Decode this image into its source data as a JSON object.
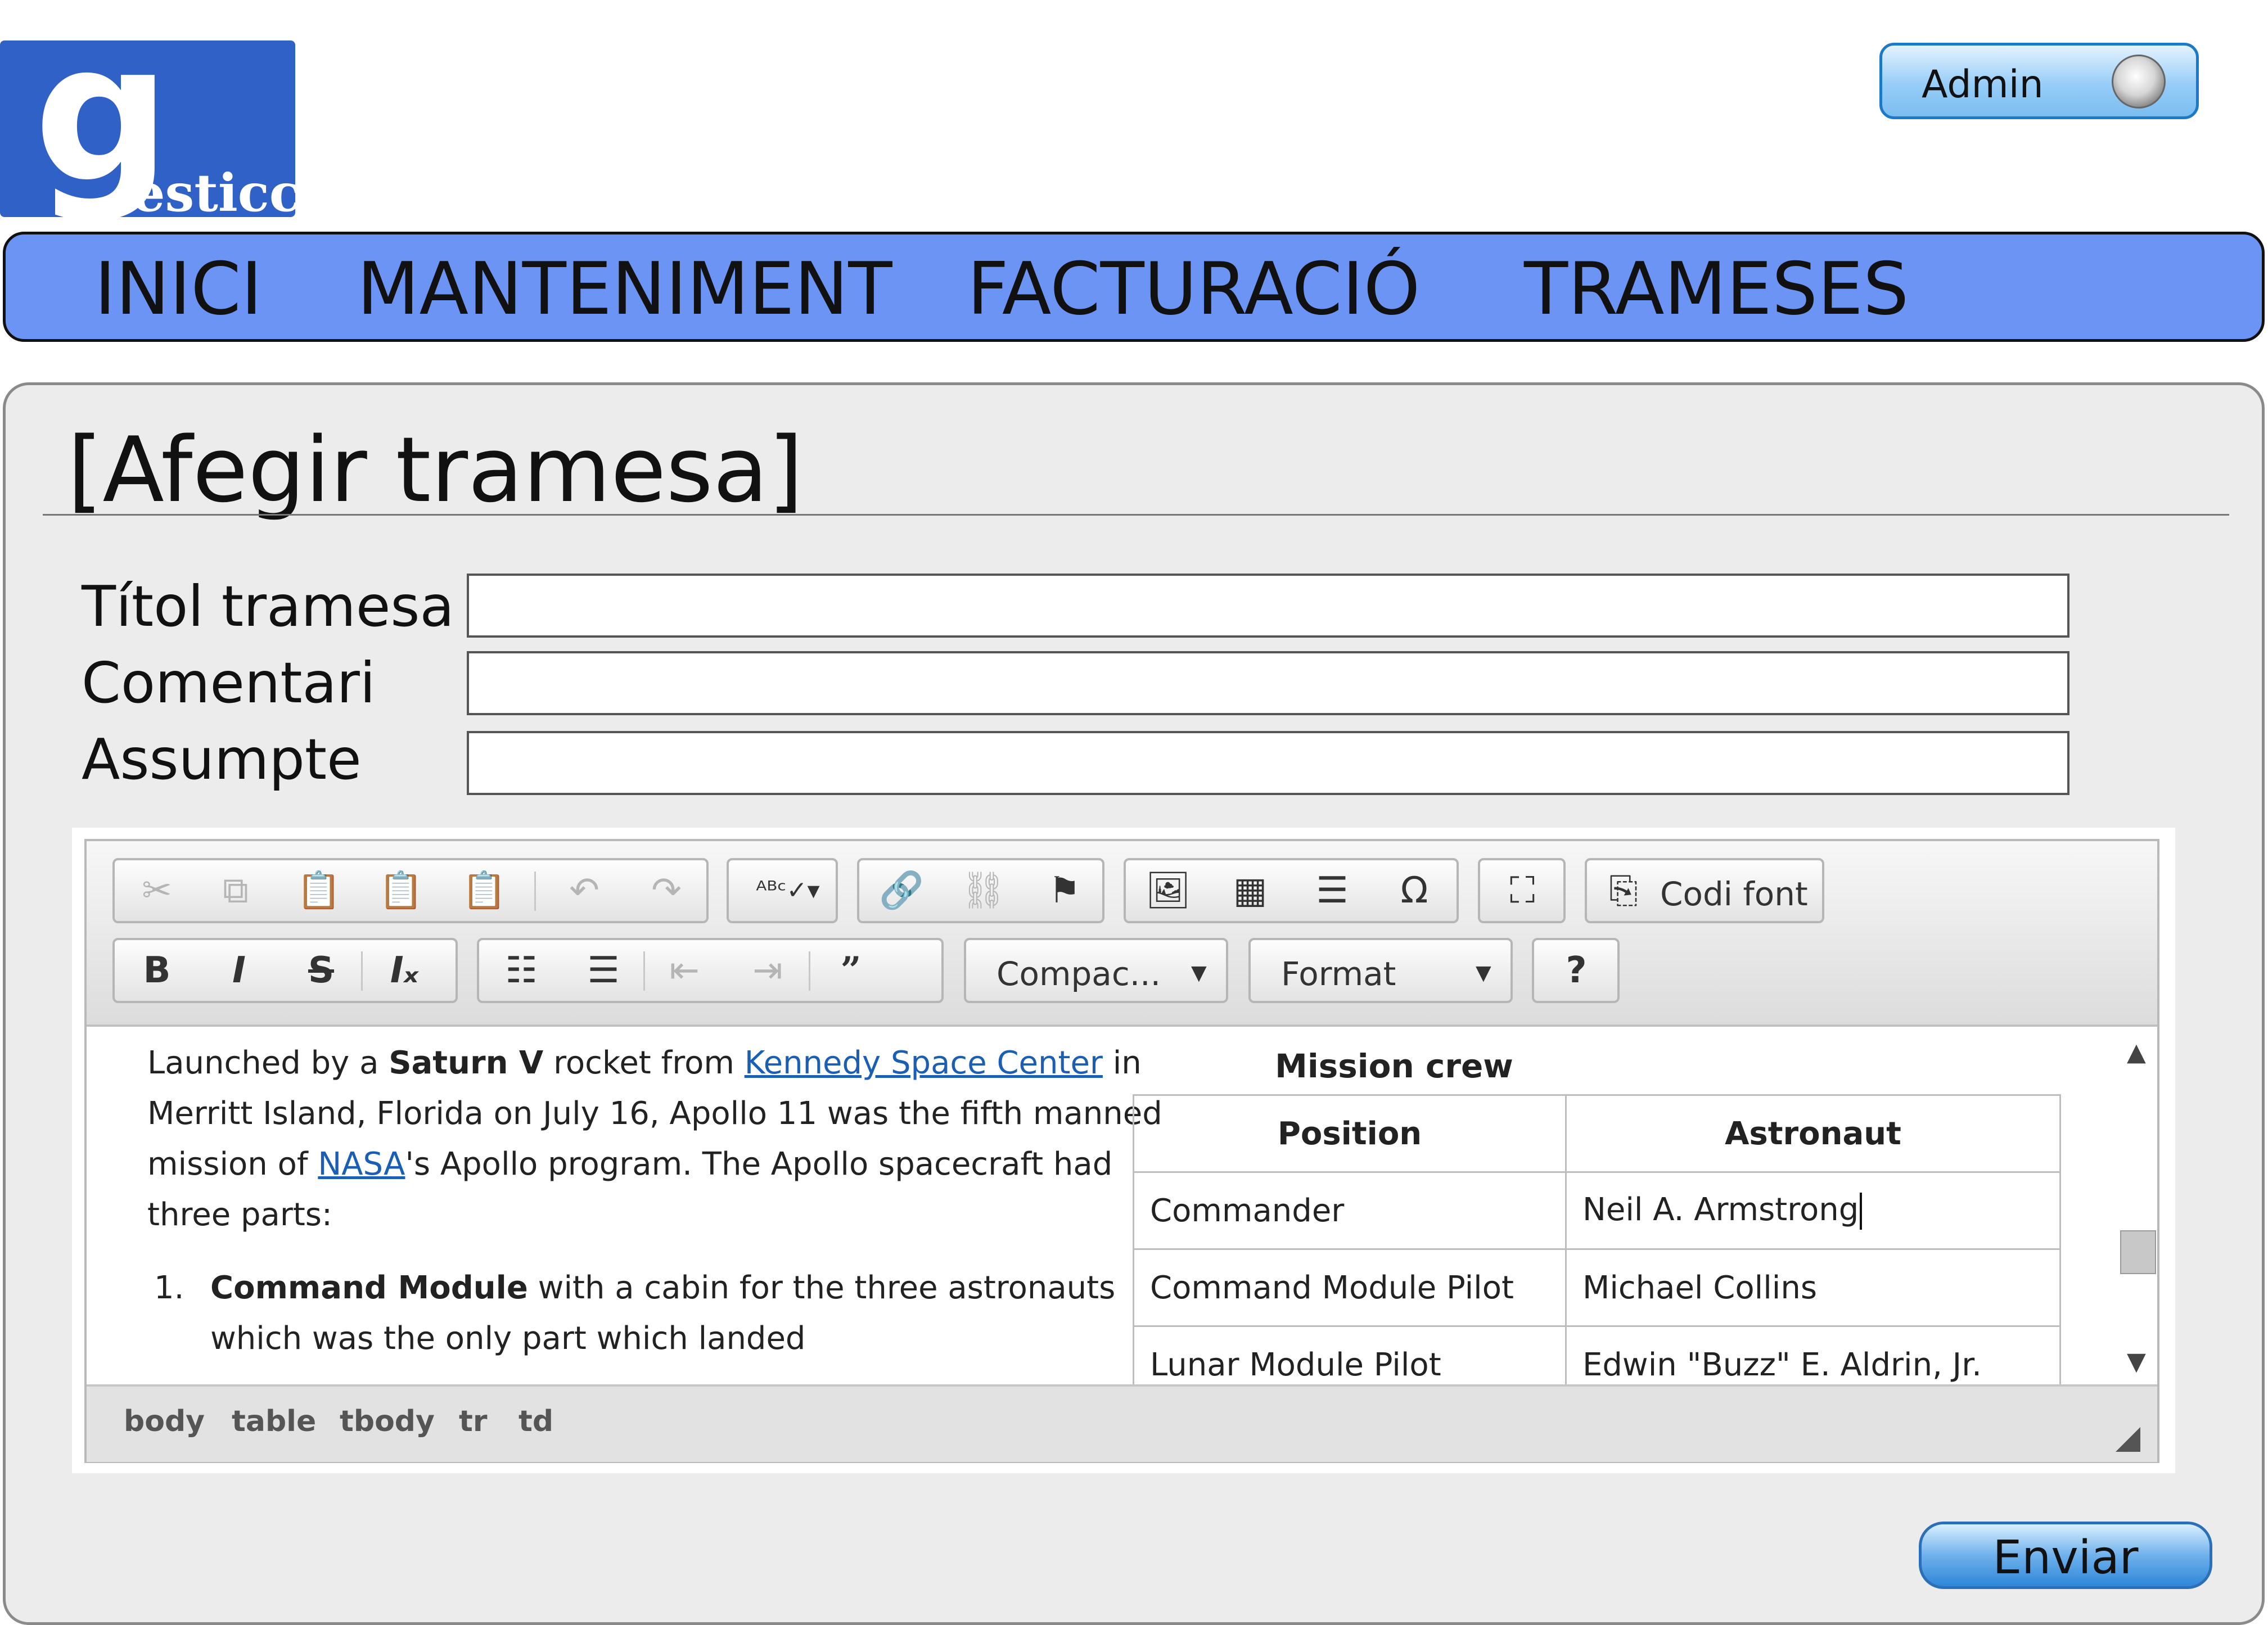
{
  "logo": {
    "big": "g",
    "rest": "esticc"
  },
  "user": {
    "label": "Admin"
  },
  "nav": [
    "INICI",
    "MANTENIMENT",
    "FACTURACIÓ",
    "TRAMESES"
  ],
  "page": {
    "title": "[Afegir tramesa]"
  },
  "form": {
    "titol_label": "Títol tramesa",
    "comentari_label": "Comentari",
    "assumpte_label": "Assumpte",
    "titol_value": "",
    "comentari_value": "",
    "assumpte_value": ""
  },
  "toolbar": {
    "source_label": "Codi font",
    "compact_label": "Compac...",
    "format_label": "Format",
    "help_label": "?",
    "icons": [
      "cut-icon",
      "copy-icon",
      "paste-icon",
      "paste-text-icon",
      "paste-word-icon",
      "undo-icon",
      "redo-icon",
      "spellcheck-icon",
      "link-icon",
      "unlink-icon",
      "anchor-icon",
      "image-icon",
      "table-icon",
      "horizontal-rule-icon",
      "special-char-icon",
      "maximize-icon",
      "source-icon",
      "bold-icon",
      "italic-icon",
      "strike-icon",
      "remove-format-icon",
      "numbered-list-icon",
      "bulleted-list-icon",
      "outdent-icon",
      "indent-icon",
      "blockquote-icon"
    ]
  },
  "content": {
    "p1": "Launched by a ",
    "p1_bold": "Saturn V",
    "p1_b": " rocket from ",
    "link1": "Kennedy Space Center",
    "p1_c": " in Merritt Island, Florida on July 16, Apollo 11 was the fifth manned mission of ",
    "link2": "NASA",
    "p1_d": "'s Apollo program. The Apollo spacecraft had three parts:",
    "li1_num": "1.",
    "li1_bold": "Command Module",
    "li1_rest": " with a cabin for the three astronauts which was the only part which landed",
    "table_caption": "Mission crew",
    "table_headers": [
      "Position",
      "Astronaut"
    ],
    "table_rows": [
      [
        "Commander",
        "Neil A. Armstrong"
      ],
      [
        "Command Module Pilot",
        "Michael Collins"
      ],
      [
        "Lunar Module Pilot",
        "Edwin \"Buzz\" E. Aldrin, Jr."
      ]
    ]
  },
  "statusbar": [
    "body",
    "table",
    "tbody",
    "tr",
    "td"
  ],
  "actions": {
    "send_label": "Enviar"
  },
  "colors": {
    "nav": "#6b94f5",
    "logo": "#2f61c7",
    "panel": "#ececec",
    "button": "#6fb1ec"
  }
}
